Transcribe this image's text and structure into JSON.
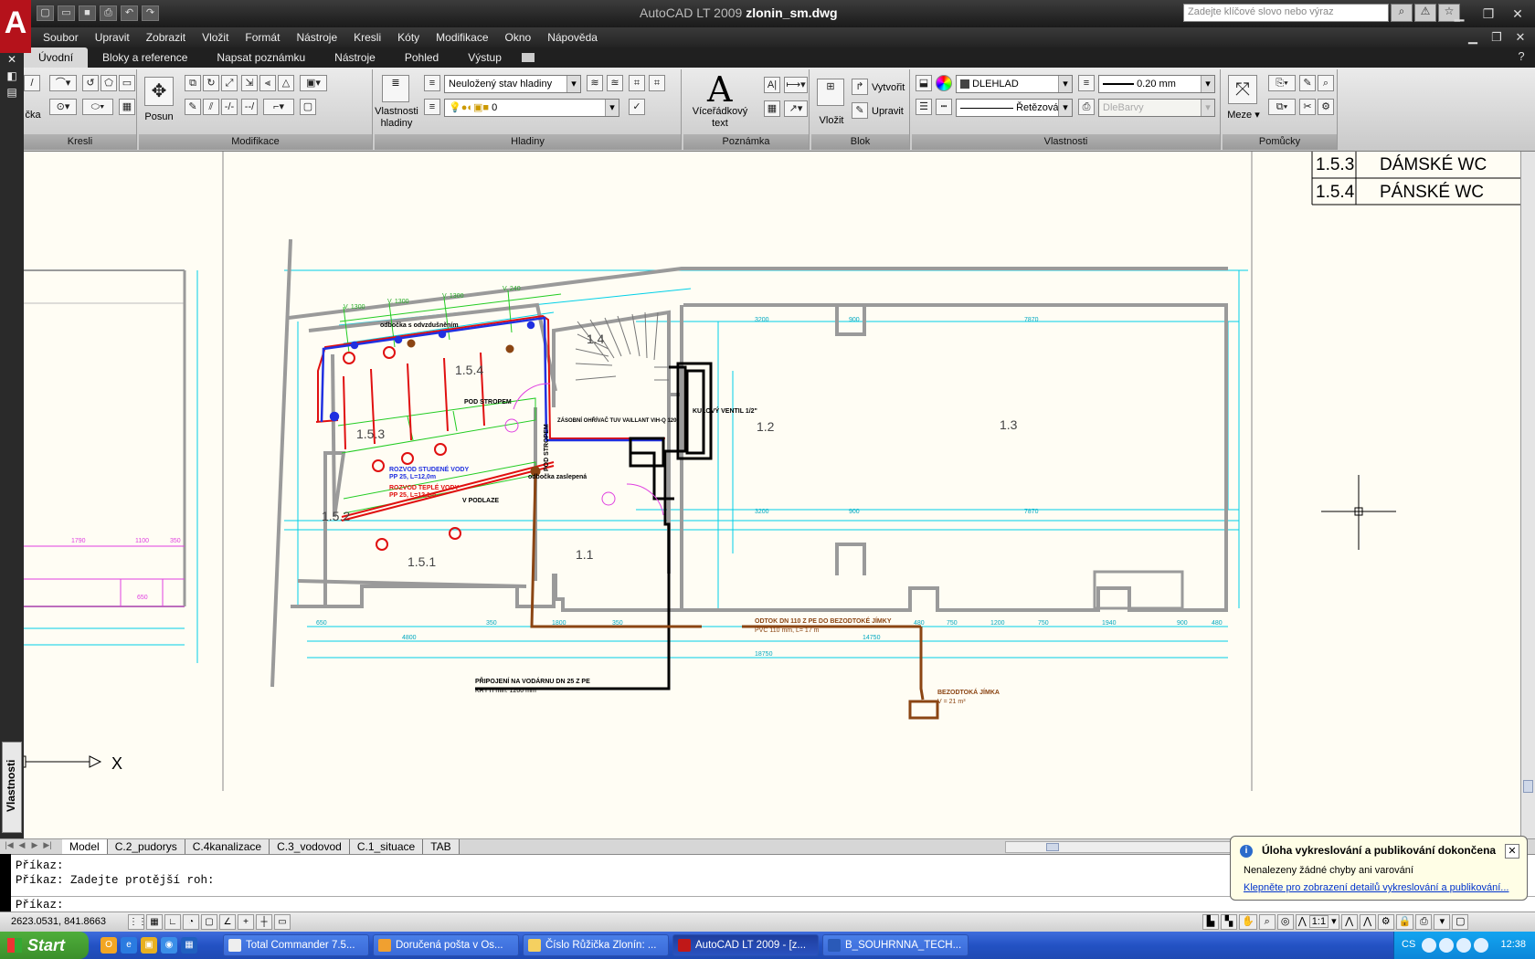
{
  "titlebar": {
    "app_logo": "A",
    "title_app": "AutoCAD LT 2009",
    "title_file": "zlonin_sm.dwg",
    "search_placeholder": "Zadejte klíčové slovo nebo výraz",
    "qat_icons": [
      "new-icon",
      "open-icon",
      "save-icon",
      "print-icon",
      "undo-icon",
      "redo-icon"
    ]
  },
  "menubar": {
    "items": [
      "Soubor",
      "Upravit",
      "Zobrazit",
      "Vložit",
      "Formát",
      "Nástroje",
      "Kresli",
      "Kóty",
      "Modifikace",
      "Okno",
      "Nápověda"
    ]
  },
  "ribbon_tabs": [
    "Úvodní",
    "Bloky a reference",
    "Napsat poznámku",
    "Nástroje",
    "Pohled",
    "Výstup"
  ],
  "ribbon": {
    "panels": {
      "kresli": "Kresli",
      "modifikace": "Modifikace",
      "hladiny": "Hladiny",
      "poznamka": "Poznámka",
      "blok": "Blok",
      "vlastnosti": "Vlastnosti",
      "pomucky": "Pomůcky"
    },
    "kresli_label": "čka",
    "posun_label": "Posun",
    "vlastnosti_hladiny_label": "Vlastnosti hladiny",
    "layer_state": "Neuložený stav hladiny",
    "layer_current": "0",
    "mtext_label": "Víceřádkový text",
    "vlozit_label": "Vložit",
    "vytvorit_label": "Vytvořit",
    "upravit_label": "Upravit",
    "color": "DLEHLAD",
    "lineweight": "0.20 mm",
    "linetype": "Řetězová",
    "plotstyle": "DleBarvy",
    "meze_label": "Meze"
  },
  "left_strip": {
    "properties_label": "Vlastnosti"
  },
  "drawing": {
    "table_rows": [
      {
        "num": "1.5.3",
        "name": "DÁMSKÉ WC"
      },
      {
        "num": "1.5.4",
        "name": "PÁNSKÉ WC"
      }
    ],
    "rooms": [
      "1.4",
      "1.5.4",
      "1.5.3",
      "1.5.2",
      "1.5.1",
      "1.1",
      "1.2",
      "1.3"
    ],
    "labels": {
      "pod_stropem": "POD STROPEM",
      "pod_stropem2": "POD STROPEM",
      "kulovy_ventil": "KULOVÝ VENTIL 1/2\"",
      "ohrivac": "ZÁSOBNÍ OHŘÍVAČ TUV VAILLANT VIH-Q 120",
      "rozvod_studene": "ROZVOD STUDENÉ VODY",
      "rozvod_studene_spec": "PP 25, L=12,0m",
      "rozvod_teple": "ROZVOD TEPLÉ VODY",
      "rozvod_teple_spec": "PP 25, L=12,1m",
      "v_podlaze": "V PODLAZE",
      "odbocka": "odbočka zaslepená",
      "odbocka_top": "odbočka s odvzdušněním",
      "pripojeni": "PŘIPOJENÍ NA VODÁRNU DN 25 Z PE",
      "pripojeni_spec": "KRYTí min. 1200 mm",
      "odtok": "ODTOK DN 110 Z PE DO BEZODTOKÉ JÍMKY",
      "odtok_spec": "PVC 110 mm, L= 17 m",
      "jimka": "BEZODTOKÁ JÍMKA",
      "jimka_spec": "V = 21 m³",
      "v1": "V. 1300",
      "v2": "V. 1300",
      "v3": "V. 1300",
      "v4": "V. 240"
    },
    "dims_bottom": [
      "650",
      "4800",
      "350",
      "1800",
      "350",
      "14750",
      "18750",
      "480",
      "750",
      "1200",
      "750",
      "1940",
      "900",
      "480"
    ],
    "dims_top": [
      "3200",
      "900",
      "7870",
      "3200",
      "900",
      "7870"
    ],
    "dims_left": [
      "1790",
      "1100",
      "350",
      "650"
    ],
    "ucs_x": "X"
  },
  "layout_tabs": [
    "Model",
    "C.2_pudorys",
    "C.4kanalizace",
    "C.3_vodovod",
    "C.1_situace",
    "TAB"
  ],
  "cmdline": {
    "line1": "Příkaz:",
    "line2": "Příkaz: Zadejte protější roh:",
    "prompt": "Příkaz:"
  },
  "statusbar": {
    "coords": "2623.0531, 841.8663",
    "scale": "1:1"
  },
  "balloon": {
    "title": "Úloha vykreslování a publikování dokončena",
    "message": "Nenalezeny žádné chyby ani varování",
    "link": "Klepněte pro zobrazení detailů vykreslování a publikování..."
  },
  "taskbar": {
    "start": "Start",
    "tasks": [
      "Total Commander 7.5...",
      "Doručená pošta v Os...",
      "Číslo Růžička Zlonín: ...",
      "AutoCAD LT 2009 - [z...",
      "B_SOUHRNNA_TECH..."
    ],
    "lang": "CS",
    "clock": "12:38"
  },
  "colors": {
    "drawing_bg": "#fffdf4",
    "cyan_dim": "#00d0e8",
    "wall_gray": "#9a9a9a",
    "red_pipe": "#e01010",
    "blue_pipe": "#2030e0",
    "green": "#22cc22",
    "brown": "#8b4513",
    "magenta": "#e040e0"
  }
}
